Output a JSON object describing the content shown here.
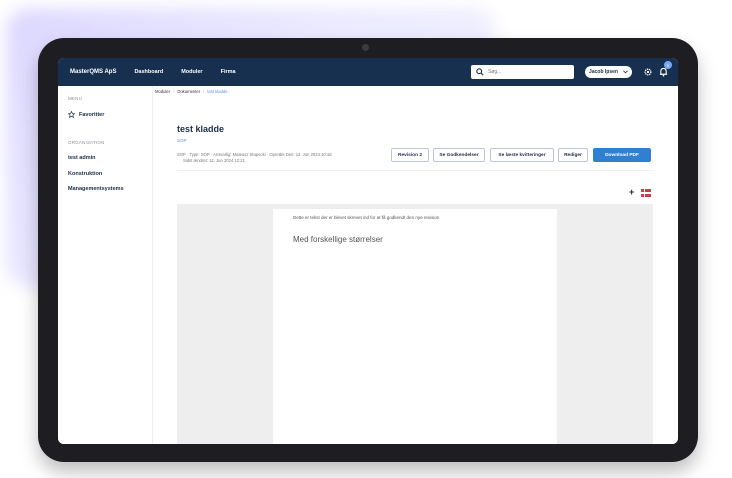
{
  "navbar": {
    "brand": "MasterQMS ApS",
    "links": [
      "Dashboard",
      "Moduler",
      "Firma"
    ],
    "search_placeholder": "Søg...",
    "user_name": "Jacob Ipsen",
    "notification_count": "0"
  },
  "sidebar": {
    "menu_heading": "MENU",
    "favorites": "Favoritter",
    "org_heading": "ORGANISATION",
    "items": [
      "test admin",
      "Konstruktion",
      "Managementsystems"
    ]
  },
  "breadcrumb": [
    "Moduler",
    "Dokumenter",
    "test kladde"
  ],
  "document": {
    "title": "test kladde",
    "subtitle": "SOP",
    "meta_line1": "SOP · Type: SOP · Ansvarlig: Mateusz Stupecki · Oprettet Den: 12. Jun 2024 10:18",
    "meta_line2": "Sidst ændret: 12. Jun 2024 12:21",
    "buttons": {
      "revision": "Revision 2",
      "approvals": "Se Godkendelser",
      "receipts": "Se læste kvitteringer",
      "edit": "Rediger",
      "download": "Download PDF"
    },
    "add_symbol": "+",
    "language_flag": "danish-flag-icon",
    "body_text": "Dette er tekst der er blevet skrevet ind for at få godkendt den nye revision",
    "body_heading": "Med forskellige størrelser"
  },
  "colors": {
    "navbar": "#17304f",
    "accent": "#2f80d0",
    "link": "#5b8ee6"
  }
}
